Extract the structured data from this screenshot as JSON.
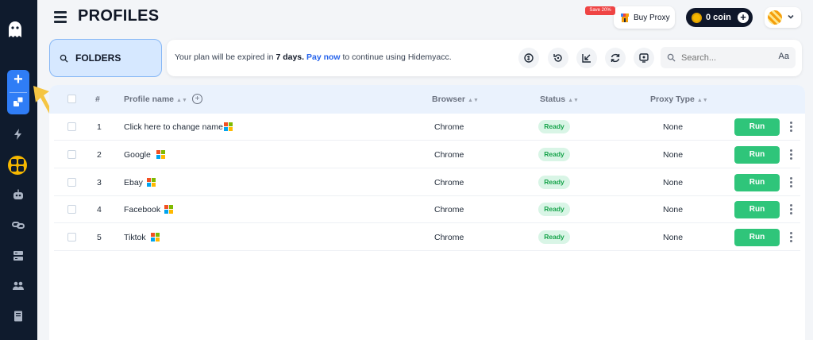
{
  "header": {
    "title": "PROFILES",
    "save_badge": "Save 20%",
    "buy_proxy_label": "Buy Proxy",
    "coin_label": "0 coin"
  },
  "sidebar": {
    "icons": [
      "ghost-logo-icon",
      "plus-icon",
      "cubes-icon",
      "lightning-icon",
      "grid-icon",
      "robot-icon",
      "link-icon",
      "server-icon",
      "team-icon",
      "book-icon"
    ]
  },
  "folders": {
    "label": "FOLDERS"
  },
  "plan": {
    "text_before": "Your plan will be expired in ",
    "days": "7 days.",
    "pay_link": "Pay now",
    "text_after": " to continue using Hidemyacc."
  },
  "search": {
    "placeholder": "Search...",
    "font_toggle": "Aa"
  },
  "table": {
    "columns": {
      "index": "#",
      "name": "Profile name",
      "browser": "Browser",
      "status": "Status",
      "proxy": "Proxy Type"
    },
    "rows": [
      {
        "index": "1",
        "name": "Click here to change name",
        "browser": "Chrome",
        "status": "Ready",
        "proxy": "None",
        "action": "Run"
      },
      {
        "index": "2",
        "name": "Google",
        "browser": "Chrome",
        "status": "Ready",
        "proxy": "None",
        "action": "Run"
      },
      {
        "index": "3",
        "name": "Ebay",
        "browser": "Chrome",
        "status": "Ready",
        "proxy": "None",
        "action": "Run"
      },
      {
        "index": "4",
        "name": "Facebook",
        "browser": "Chrome",
        "status": "Ready",
        "proxy": "None",
        "action": "Run"
      },
      {
        "index": "5",
        "name": "Tiktok",
        "browser": "Chrome",
        "status": "Ready",
        "proxy": "None",
        "action": "Run"
      }
    ]
  },
  "colors": {
    "sidebar_bg": "#0f1b2d",
    "accent_blue": "#2f7df6",
    "run_green": "#2fc57a",
    "ready_text": "#16a34a",
    "annotation_arrow": "#f5c542"
  }
}
